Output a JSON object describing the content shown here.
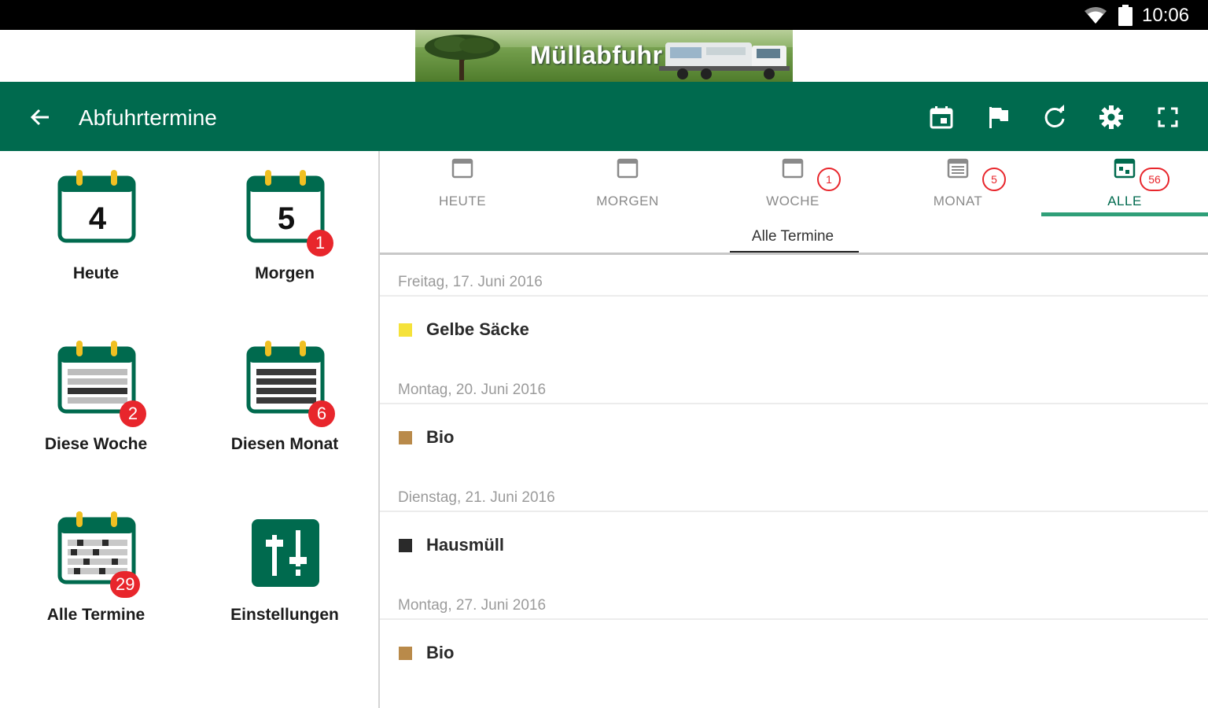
{
  "status_bar": {
    "time": "10:06"
  },
  "banner": {
    "title": "Müllabfuhr"
  },
  "toolbar": {
    "title": "Abfuhrtermine",
    "actions": [
      "calendar-today-icon",
      "flag-icon",
      "refresh-icon",
      "settings-icon",
      "fullscreen-icon"
    ]
  },
  "colors": {
    "primary": "#006a4e",
    "accent": "#2f9f78",
    "badge": "#e8262c",
    "gelbe_saecke": "#f5e23a",
    "bio": "#b98a4a",
    "hausmuell": "#2a2a2a"
  },
  "tiles": [
    {
      "label": "Heute",
      "day": "4",
      "badge": ""
    },
    {
      "label": "Morgen",
      "day": "5",
      "badge": "1"
    },
    {
      "label": "Diese Woche",
      "badge": "2"
    },
    {
      "label": "Diesen Monat",
      "badge": "6"
    },
    {
      "label": "Alle Termine",
      "badge": "29"
    },
    {
      "label": "Einstellungen",
      "badge": ""
    }
  ],
  "tabs": [
    {
      "label": "HEUTE",
      "badge": ""
    },
    {
      "label": "MORGEN",
      "badge": ""
    },
    {
      "label": "WOCHE",
      "badge": "1"
    },
    {
      "label": "MONAT",
      "badge": "5"
    },
    {
      "label": "ALLE",
      "badge": "56",
      "active": true
    }
  ],
  "subtitle": "Alle Termine",
  "schedule": [
    {
      "date": "Freitag, 17. Juni 2016",
      "item": "Gelbe Säcke",
      "color": "#f5e23a"
    },
    {
      "date": "Montag, 20. Juni 2016",
      "item": "Bio",
      "color": "#b98a4a"
    },
    {
      "date": "Dienstag, 21. Juni 2016",
      "item": "Hausmüll",
      "color": "#2a2a2a"
    },
    {
      "date": "Montag, 27. Juni 2016",
      "item": "Bio",
      "color": "#b98a4a"
    }
  ]
}
